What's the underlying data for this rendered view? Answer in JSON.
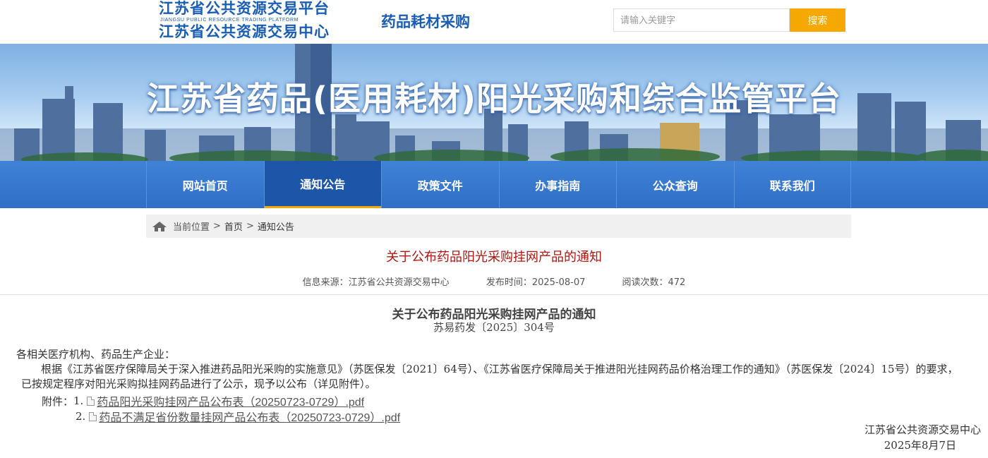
{
  "header": {
    "logo_line1": "江苏省公共资源交易平台",
    "logo_line2": "JIANGSU PUBLIC RESOURCE TRADING PLATFORM",
    "logo_line3": "江苏省公共资源交易中心",
    "subtitle": "药品耗材采购",
    "search_placeholder": "请输入关键字",
    "search_button": "搜索"
  },
  "banner": {
    "title": "江苏省药品(医用耗材)阳光采购和综合监管平台"
  },
  "nav": {
    "items": [
      {
        "label": "网站首页"
      },
      {
        "label": "通知公告"
      },
      {
        "label": "政策文件"
      },
      {
        "label": "办事指南"
      },
      {
        "label": "公众查询"
      },
      {
        "label": "联系我们"
      }
    ],
    "active_index": 1
  },
  "breadcrumb": {
    "prefix": "当前位置",
    "sep": ">",
    "items": [
      "首页",
      "通知公告"
    ]
  },
  "article": {
    "title": "关于公布药品阳光采购挂网产品的通知",
    "source": "信息来源：江苏省公共资源交易中心",
    "publish_time": "发布时间：2025-08-07",
    "views": "阅读次数：472"
  },
  "document": {
    "title": "关于公布药品阳光采购挂网产品的通知",
    "number": "苏易药发〔2025〕304号",
    "greeting": "各相关医疗机构、药品生产企业：",
    "body": "根据《江苏省医疗保障局关于深入推进药品阳光采购的实施意见》（苏医保发〔2021〕64号）、《江苏省医疗保障局关于推进阳光挂网药品价格治理工作的通知》（苏医保发〔2024〕15号）的要求，已按规定程序对阳光采购拟挂网药品进行了公示，现予以公布（详见附件）。",
    "attachments_label": "附件：",
    "attachments": [
      {
        "num": "1.",
        "name": "药品阳光采购挂网产品公布表（20250723-0729）.pdf"
      },
      {
        "num": "2.",
        "name": "药品不满足省份数量挂网产品公布表（20250723-0729）.pdf"
      }
    ],
    "signature_org": "江苏省公共资源交易中心",
    "signature_date": "2025年8月7日"
  },
  "colors": {
    "brand_blue": "#1a5db5",
    "nav_blue": "#2f6fc6",
    "nav_active": "#1d56a8",
    "accent_orange": "#f4a800",
    "title_red": "#b3150e"
  }
}
